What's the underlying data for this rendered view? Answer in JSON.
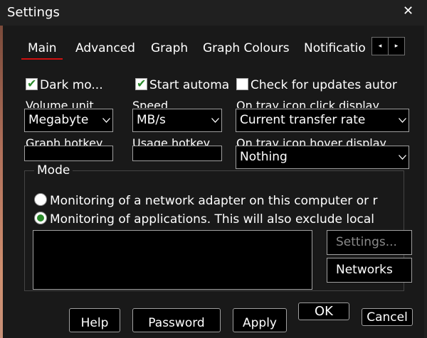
{
  "window": {
    "title": "Settings",
    "close_glyph": "✕"
  },
  "tabs": [
    {
      "label": "Main",
      "selected": true
    },
    {
      "label": "Advanced",
      "selected": false
    },
    {
      "label": "Graph",
      "selected": false
    },
    {
      "label": "Graph Colours",
      "selected": false
    },
    {
      "label": "Notificatio",
      "selected": false
    }
  ],
  "tab_scroll": {
    "left_glyph": "◂",
    "right_glyph": "▸"
  },
  "checkboxes": [
    {
      "label": "Dark mo...",
      "checked": true
    },
    {
      "label": "Start automa",
      "checked": true
    },
    {
      "label": "Check for updates autor",
      "checked": false
    }
  ],
  "fields": {
    "volume_unit": {
      "label": "Volume unit",
      "value": "Megabyte"
    },
    "speed": {
      "label": "Speed",
      "value": "MB/s"
    },
    "tray_click": {
      "label": "On tray icon click display",
      "value": "Current transfer rate"
    },
    "graph_hotkey": {
      "label": "Graph hotkey",
      "value": ""
    },
    "usage_hotkey": {
      "label": "Usage hotkey",
      "value": ""
    },
    "tray_hover": {
      "label": "On tray icon hover display",
      "value": "Nothing"
    }
  },
  "mode": {
    "title": "Mode",
    "options": [
      {
        "label": "Monitoring of a network adapter on this computer or r",
        "selected": false
      },
      {
        "label": "Monitoring of applications. This will also exclude local",
        "selected": true
      }
    ],
    "settings_label": "Settings...",
    "networks_label": "Networks"
  },
  "buttons": {
    "help": "Help",
    "password": "Password",
    "apply": "Apply",
    "ok": "OK",
    "cancel": "Cancel"
  },
  "colors": {
    "accent_tab": "#d01010",
    "check_green": "#2b8a2b",
    "background": "#191919"
  }
}
